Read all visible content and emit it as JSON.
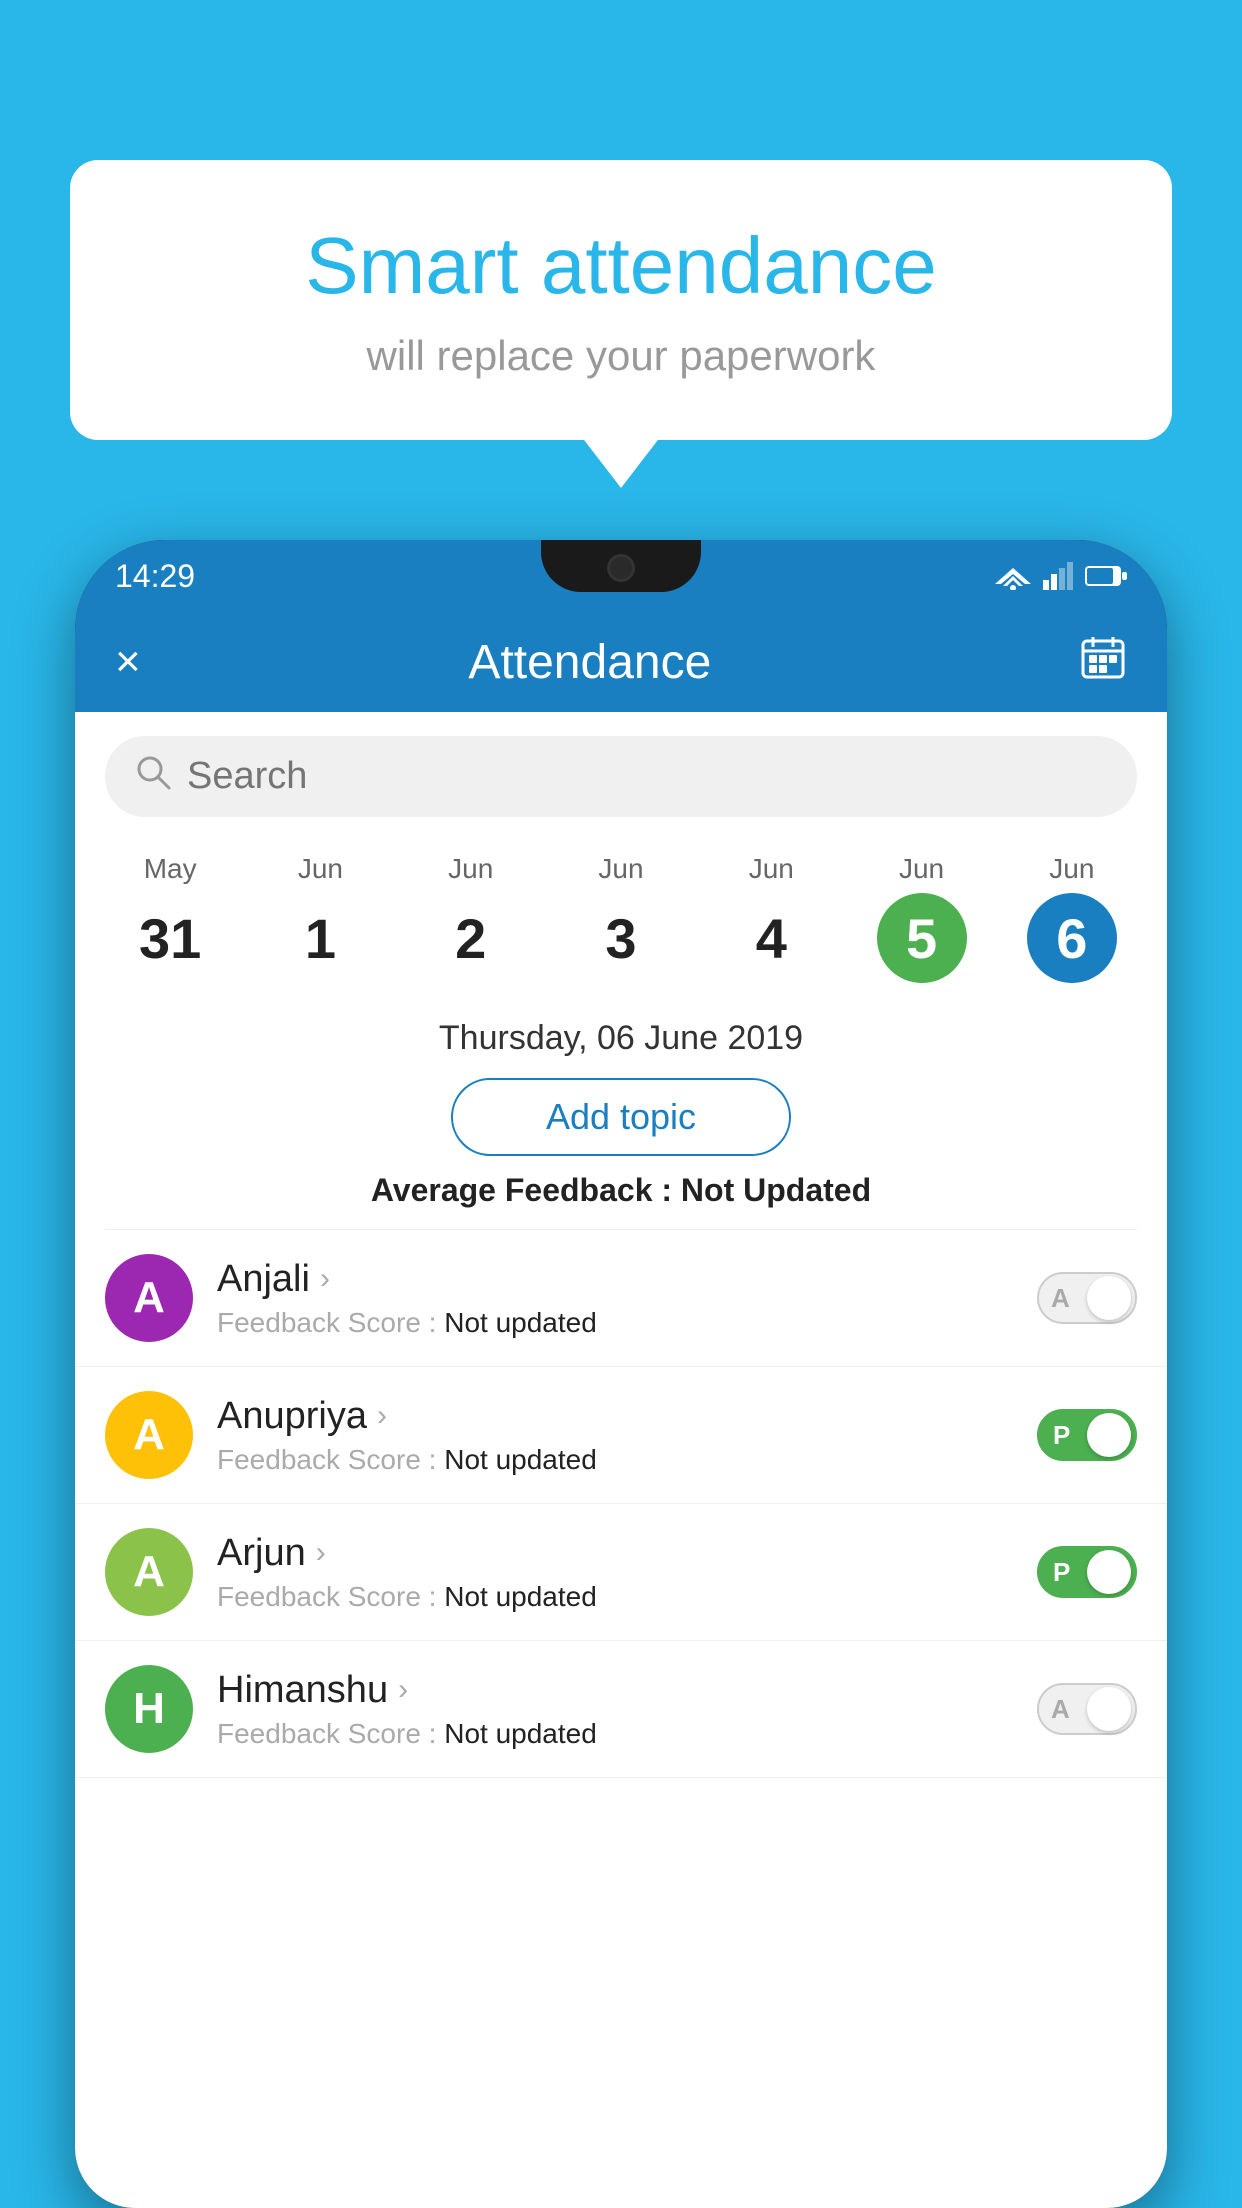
{
  "background_color": "#29b6e8",
  "bubble": {
    "headline": "Smart attendance",
    "subline": "will replace your paperwork"
  },
  "status_bar": {
    "time": "14:29"
  },
  "app_bar": {
    "title": "Attendance",
    "close_label": "×",
    "calendar_label": "📅"
  },
  "search": {
    "placeholder": "Search"
  },
  "dates": [
    {
      "month": "May",
      "day": "31",
      "style": "normal"
    },
    {
      "month": "Jun",
      "day": "1",
      "style": "normal"
    },
    {
      "month": "Jun",
      "day": "2",
      "style": "normal"
    },
    {
      "month": "Jun",
      "day": "3",
      "style": "normal"
    },
    {
      "month": "Jun",
      "day": "4",
      "style": "normal"
    },
    {
      "month": "Jun",
      "day": "5",
      "style": "selected-green"
    },
    {
      "month": "Jun",
      "day": "6",
      "style": "selected-blue"
    }
  ],
  "selected_date": "Thursday, 06 June 2019",
  "add_topic_label": "Add topic",
  "avg_feedback_label": "Average Feedback :",
  "avg_feedback_value": "Not Updated",
  "students": [
    {
      "name": "Anjali",
      "avatar_letter": "A",
      "avatar_color": "purple",
      "feedback_label": "Feedback Score :",
      "feedback_value": "Not updated",
      "toggle_active": false,
      "toggle_letter": "A"
    },
    {
      "name": "Anupriya",
      "avatar_letter": "A",
      "avatar_color": "yellow",
      "feedback_label": "Feedback Score :",
      "feedback_value": "Not updated",
      "toggle_active": true,
      "toggle_letter": "P"
    },
    {
      "name": "Arjun",
      "avatar_letter": "A",
      "avatar_color": "green-light",
      "feedback_label": "Feedback Score :",
      "feedback_value": "Not updated",
      "toggle_active": true,
      "toggle_letter": "P"
    },
    {
      "name": "Himanshu",
      "avatar_letter": "H",
      "avatar_color": "green-dark",
      "feedback_label": "Feedback Score :",
      "feedback_value": "Not updated",
      "toggle_active": false,
      "toggle_letter": "A"
    }
  ]
}
